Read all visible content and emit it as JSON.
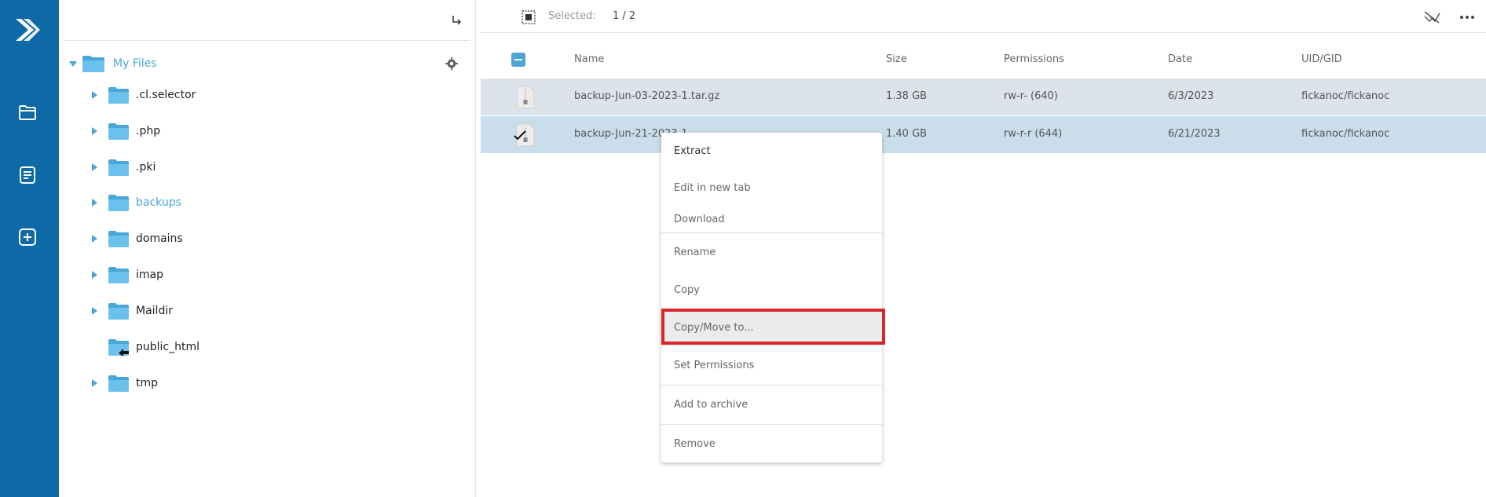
{
  "tree": {
    "root_label": "My Files",
    "items": [
      {
        "label": ".cl.selector",
        "has_children": true,
        "active": false,
        "special": false
      },
      {
        "label": ".php",
        "has_children": true,
        "active": false,
        "special": false
      },
      {
        "label": ".pki",
        "has_children": true,
        "active": false,
        "special": false
      },
      {
        "label": "backups",
        "has_children": true,
        "active": true,
        "special": false
      },
      {
        "label": "domains",
        "has_children": true,
        "active": false,
        "special": false
      },
      {
        "label": "imap",
        "has_children": true,
        "active": false,
        "special": false
      },
      {
        "label": "Maildir",
        "has_children": true,
        "active": false,
        "special": false
      },
      {
        "label": "public_html",
        "has_children": false,
        "active": false,
        "special": true
      },
      {
        "label": "tmp",
        "has_children": true,
        "active": false,
        "special": false
      }
    ]
  },
  "toolbar": {
    "selected_label": "Selected:",
    "selected_count": "1 / 2"
  },
  "table": {
    "headers": {
      "name": "Name",
      "size": "Size",
      "permissions": "Permissions",
      "date": "Date",
      "uid": "UID/GID"
    },
    "rows": [
      {
        "name": "backup-Jun-03-2023-1.tar.gz",
        "size": "1.38 GB",
        "permissions": "rw-r- (640)",
        "date": "6/3/2023",
        "uid": "fickanoc/fickanoc",
        "selected": false
      },
      {
        "name": "backup-Jun-21-2023-1...",
        "size": "1.40 GB",
        "permissions": "rw-r-r (644)",
        "date": "6/21/2023",
        "uid": "fickanoc/fickanoc",
        "selected": true
      }
    ]
  },
  "context_menu": {
    "extract": "Extract",
    "edit_new_tab": "Edit in new tab",
    "download": "Download",
    "rename": "Rename",
    "copy": "Copy",
    "copy_move": "Copy/Move to...",
    "set_permissions": "Set Permissions",
    "add_archive": "Add to archive",
    "remove": "Remove"
  },
  "colors": {
    "rail": "#0d6aa6",
    "accent": "#4aa6d6",
    "highlight": "#d9262c"
  }
}
